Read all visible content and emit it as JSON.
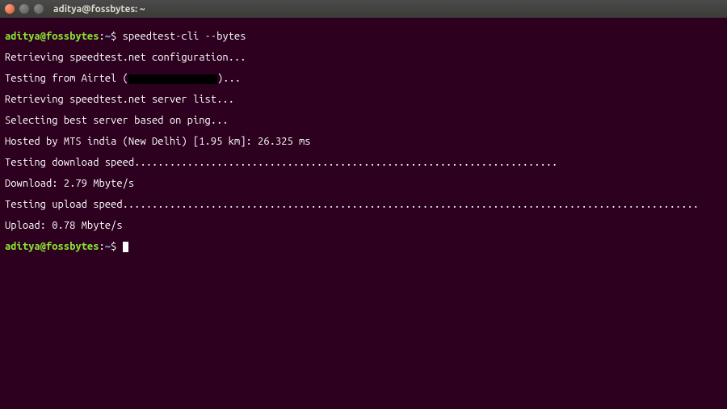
{
  "titlebar": {
    "title": "aditya@fossbytes: ~"
  },
  "prompt": {
    "user_host": "aditya@fossbytes",
    "colon": ":",
    "path": "~",
    "symbol": "$"
  },
  "session": {
    "command1": "speedtest-cli --bytes",
    "out": {
      "l1": "Retrieving speedtest.net configuration...",
      "l2a": "Testing from Airtel (",
      "l2b": ")...",
      "l3": "Retrieving speedtest.net server list...",
      "l4": "Selecting best server based on ping...",
      "l5": "Hosted by MTS india (New Delhi) [1.95 km]: 26.325 ms",
      "l6": "Testing download speed........................................................................",
      "l7": "Download: 2.79 Mbyte/s",
      "l8": "Testing upload speed..................................................................................................",
      "l9": "Upload: 0.78 Mbyte/s"
    }
  }
}
